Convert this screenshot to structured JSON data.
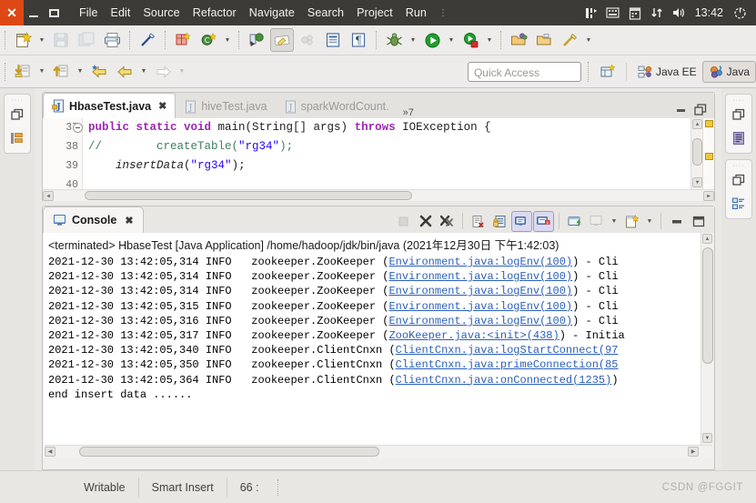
{
  "window": {
    "menubar": {
      "window_controls": [
        "close",
        "minimize",
        "maximize"
      ],
      "items": [
        "File",
        "Edit",
        "Source",
        "Refactor",
        "Navigate",
        "Search",
        "Project",
        "Run"
      ],
      "overflow": "⋮",
      "tray": {
        "icons": [
          "network-icon",
          "keyboard-icon",
          "calendar-icon",
          "updates-icon",
          "volume-icon",
          "power-icon"
        ],
        "clock": "13:42"
      }
    }
  },
  "toolbar1": {
    "buttons": [
      {
        "name": "new-wizard-icon",
        "label": "New"
      },
      {
        "name": "new-dropdown-arrow",
        "label": ""
      },
      {
        "name": "save-icon",
        "label": "Save"
      },
      {
        "name": "save-all-icon",
        "label": "Save All"
      },
      {
        "name": "print-icon",
        "label": "Print"
      },
      {
        "name": "quick-fix-icon",
        "label": "Quick Fix"
      },
      {
        "name": "new-java-package-icon",
        "label": "New Java Package"
      },
      {
        "name": "new-java-class-icon",
        "label": "New Java Class"
      },
      {
        "name": "new-class-dropdown-arrow",
        "label": ""
      },
      {
        "name": "open-type-icon",
        "label": "Open Type"
      },
      {
        "name": "toggle-mark-occurrences-icon",
        "label": "Toggle Mark Occurrences"
      },
      {
        "name": "skip-breakpoints-icon",
        "label": "Skip All Breakpoints"
      },
      {
        "name": "open-task-icon",
        "label": "Open Task"
      },
      {
        "name": "show-whitespace-icon",
        "label": "Show Whitespace Characters"
      },
      {
        "name": "debug-icon",
        "label": "Debug"
      },
      {
        "name": "debug-dropdown-arrow",
        "label": ""
      },
      {
        "name": "run-icon",
        "label": "Run"
      },
      {
        "name": "run-dropdown-arrow",
        "label": ""
      },
      {
        "name": "coverage-icon",
        "label": "Coverage"
      },
      {
        "name": "coverage-dropdown-arrow",
        "label": ""
      },
      {
        "name": "external-tools-icon",
        "label": "External Tools"
      },
      {
        "name": "open-folder-icon",
        "label": "Open Folder"
      },
      {
        "name": "search-pen-icon",
        "label": "Search"
      },
      {
        "name": "search-dropdown-arrow",
        "label": ""
      }
    ]
  },
  "toolbar2": {
    "buttons": [
      {
        "name": "next-annotation-icon",
        "label": "Next Annotation"
      },
      {
        "name": "next-annotation-arrow",
        "label": ""
      },
      {
        "name": "previous-annotation-icon",
        "label": "Previous Annotation"
      },
      {
        "name": "previous-annotation-arrow",
        "label": ""
      },
      {
        "name": "last-edit-location-icon",
        "label": "Last Edit Location"
      },
      {
        "name": "back-icon",
        "label": "Back"
      },
      {
        "name": "back-arrow",
        "label": ""
      },
      {
        "name": "forward-icon",
        "label": "Forward"
      },
      {
        "name": "forward-arrow",
        "label": ""
      }
    ],
    "quick_access_placeholder": "Quick Access",
    "open-perspective-icon": "open-perspective",
    "perspectives": [
      {
        "name": "perspective-java-ee",
        "label": "Java EE",
        "active": false
      },
      {
        "name": "perspective-java",
        "label": "Java",
        "active": true
      }
    ]
  },
  "left_dock": {
    "group": {
      "restore_icon": "restore-icon",
      "items": [
        {
          "name": "package-explorer-icon",
          "label": "Package Explorer"
        }
      ]
    }
  },
  "right_dock": {
    "groups": [
      {
        "restore_icon": "restore-icon",
        "items": [
          {
            "name": "task-list-icon",
            "label": "Task List"
          }
        ]
      },
      {
        "restore_icon": "restore-icon",
        "items": [
          {
            "name": "outline-icon",
            "label": "Outline"
          }
        ]
      }
    ]
  },
  "editor": {
    "tabs": [
      {
        "label": "HbaseTest.java",
        "active": true,
        "closable": true,
        "icon": "java-file-icon"
      },
      {
        "label": "hiveTest.java",
        "active": false,
        "closable": false,
        "icon": "java-file-icon"
      },
      {
        "label": "sparkWordCount.",
        "active": false,
        "closable": false,
        "icon": "java-file-icon"
      }
    ],
    "overflow_label": "»7",
    "controls": [
      {
        "name": "minimize-editor-button",
        "label": "Minimize"
      },
      {
        "name": "maximize-editor-button",
        "label": "Maximize"
      }
    ],
    "code": [
      {
        "number": "37",
        "folded": true,
        "tokens": [
          {
            "t": "        ",
            "c": "pln"
          },
          {
            "t": "public static void ",
            "c": "kw"
          },
          {
            "t": "main(String[] args) ",
            "c": "pln"
          },
          {
            "t": "throws ",
            "c": "kw"
          },
          {
            "t": "IOException {",
            "c": "pln"
          }
        ]
      },
      {
        "number": "38",
        "folded": false,
        "tokens": [
          {
            "t": "//",
            "c": "cm"
          },
          {
            "t": "        createTable(",
            "c": "cm2"
          },
          {
            "t": "\"rg34\"",
            "c": "str"
          },
          {
            "t": ");",
            "c": "pln"
          }
        ]
      },
      {
        "number": "39",
        "folded": false,
        "tokens": [
          {
            "t": "        ",
            "c": "pln"
          },
          {
            "t": "insertData",
            "c": "mth"
          },
          {
            "t": "(",
            "c": "pln"
          },
          {
            "t": "\"rg34\"",
            "c": "str"
          },
          {
            "t": ");",
            "c": "pln"
          }
        ]
      },
      {
        "number": "40",
        "folded": false,
        "tokens": [
          {
            "t": "",
            "c": "pln"
          }
        ]
      }
    ]
  },
  "console": {
    "tab": {
      "label": "Console",
      "icon": "console-icon",
      "close_icon": "close-icon"
    },
    "tools": [
      {
        "name": "terminate-button",
        "label": "Terminate",
        "state": "disabled"
      },
      {
        "name": "remove-launch-button",
        "label": "Remove Launch",
        "state": "enabled"
      },
      {
        "name": "remove-all-terminated-button",
        "label": "Remove All Terminated Launches",
        "state": "enabled"
      },
      {
        "name": "clear-console-button",
        "label": "Clear Console",
        "state": "enabled"
      },
      {
        "name": "scroll-lock-button",
        "label": "Scroll Lock",
        "state": "enabled"
      },
      {
        "name": "show-console-on-output-button",
        "label": "Show Console When Standard Out Changes",
        "state": "toggled"
      },
      {
        "name": "show-console-on-error-button",
        "label": "Show Console When Standard Error Changes",
        "state": "toggled"
      },
      {
        "name": "pin-console-button",
        "label": "Pin Console",
        "state": "enabled"
      },
      {
        "name": "display-selected-console-button",
        "label": "Display Selected Console",
        "state": "disabled"
      },
      {
        "name": "display-console-dropdown-arrow",
        "label": "",
        "state": "enabled"
      },
      {
        "name": "open-console-button",
        "label": "Open Console",
        "state": "enabled"
      },
      {
        "name": "open-console-dropdown-arrow",
        "label": "",
        "state": "enabled"
      },
      {
        "name": "minimize-console-button",
        "label": "Minimize",
        "state": "enabled"
      },
      {
        "name": "maximize-console-button",
        "label": "Maximize",
        "state": "enabled"
      }
    ],
    "header": "<terminated> HbaseTest [Java Application] /home/hadoop/jdk/bin/java (2021年12月30日 下午1:42:03)",
    "lines": [
      {
        "prefix": "2021-12-30 13:42:05,314 INFO   zookeeper.ZooKeeper (",
        "link": "Environment.java:logEnv(100)",
        "suffix": ") - Cli"
      },
      {
        "prefix": "2021-12-30 13:42:05,314 INFO   zookeeper.ZooKeeper (",
        "link": "Environment.java:logEnv(100)",
        "suffix": ") - Cli"
      },
      {
        "prefix": "2021-12-30 13:42:05,314 INFO   zookeeper.ZooKeeper (",
        "link": "Environment.java:logEnv(100)",
        "suffix": ") - Cli"
      },
      {
        "prefix": "2021-12-30 13:42:05,315 INFO   zookeeper.ZooKeeper (",
        "link": "Environment.java:logEnv(100)",
        "suffix": ") - Cli"
      },
      {
        "prefix": "2021-12-30 13:42:05,316 INFO   zookeeper.ZooKeeper (",
        "link": "Environment.java:logEnv(100)",
        "suffix": ") - Cli"
      },
      {
        "prefix": "2021-12-30 13:42:05,317 INFO   zookeeper.ZooKeeper (",
        "link": "ZooKeeper.java:<init>(438)",
        "suffix": ") - Initia"
      },
      {
        "prefix": "2021-12-30 13:42:05,340 INFO   zookeeper.ClientCnxn (",
        "link": "ClientCnxn.java:logStartConnect(97",
        "suffix": ""
      },
      {
        "prefix": "2021-12-30 13:42:05,350 INFO   zookeeper.ClientCnxn (",
        "link": "ClientCnxn.java:primeConnection(85",
        "suffix": ""
      },
      {
        "prefix": "2021-12-30 13:42:05,364 INFO   zookeeper.ClientCnxn (",
        "link": "ClientCnxn.java:onConnected(1235)",
        "suffix": ")"
      },
      {
        "prefix": "end insert data ......",
        "link": "",
        "suffix": ""
      }
    ]
  },
  "statusbar": {
    "cells": [
      {
        "name": "status-writable",
        "label": "Writable"
      },
      {
        "name": "status-insert-mode",
        "label": "Smart Insert"
      },
      {
        "name": "status-cursor-position",
        "label": "66 :"
      }
    ],
    "watermark": "CSDN @FGGIT"
  },
  "colors": {
    "accent_orange": "#dd4814",
    "menubar_bg": "#3c3b37",
    "chrome_bg": "#edecea",
    "link_blue": "#2b5fb8",
    "keyword_purple": "#9c27b0",
    "string_blue": "#2a00ff",
    "comment_green": "#3f7f5f"
  }
}
